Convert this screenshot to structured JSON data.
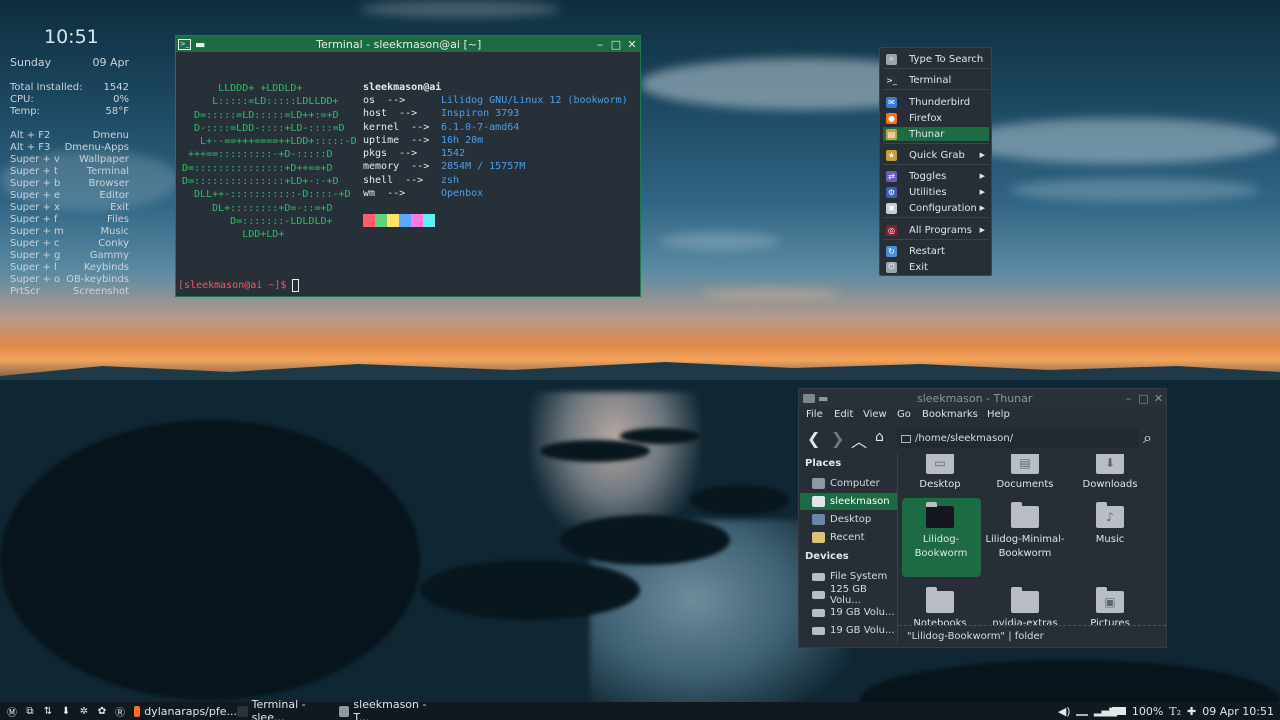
{
  "conky": {
    "time": "10:51",
    "day": "Sunday",
    "date": "09 Apr",
    "stats": [
      {
        "label": "Total Installed:",
        "value": "1542"
      },
      {
        "label": "CPU:",
        "value": "0%"
      },
      {
        "label": "Temp:",
        "value": "58°F"
      }
    ],
    "keybinds": [
      {
        "key": "Alt + F2",
        "action": "Dmenu"
      },
      {
        "key": "Alt + F3",
        "action": "Dmenu-Apps"
      },
      {
        "key": "Super + v",
        "action": "Wallpaper"
      },
      {
        "key": "Super + t",
        "action": "Terminal"
      },
      {
        "key": "Super + b",
        "action": "Browser"
      },
      {
        "key": "Super + e",
        "action": "Editor"
      },
      {
        "key": "Super + x",
        "action": "Exit"
      },
      {
        "key": "Super + f",
        "action": "Files"
      },
      {
        "key": "Super + m",
        "action": "Music"
      },
      {
        "key": "Super + c",
        "action": "Conky"
      },
      {
        "key": "Super + g",
        "action": "Gammy"
      },
      {
        "key": "Super + l",
        "action": "Keybinds"
      },
      {
        "key": "Super + o",
        "action": "OB-keybinds"
      },
      {
        "key": "PrtScr",
        "action": "Screenshot"
      }
    ]
  },
  "terminal": {
    "title": "Terminal - sleekmason@ai [~]",
    "logo": "      LLDDD+ +LDDLD+\n     L:::::=LD:::::LDLLDD+\n  D=:::::=LD:::::=LD++:=+D\n  D-::::=LDD-::::+LD-::::=D\n   L+--==+++====++LDD+:::::-D\n +++==:::::::::-+D-:::::D\nD=:::::::::::::::+D++==+D\nD=:::::::::::::::+LD+-:-+D\n  DLL++-:::::::::::-D::::-+D\n     DL+::::::::+D=-::=+D\n        D=:::::::-LDLDLD+\n          LDD+LD+",
    "user": "sleekmason@ai",
    "info_keys": "os  -->\nhost  -->\nkernel  -->\nuptime  -->\npkgs  -->\nmemory  -->\nshell  -->\nwm  -->",
    "info_values": "Lilidog GNU/Linux 12 (bookworm)\nInspiron 3793\n6.1.0-7-amd64\n16h 20m\n1542\n2854M / 15757M\nzsh\nOpenbox",
    "palette": [
      "#ff5c6e",
      "#5fd37a",
      "#ffe26a",
      "#5aa7ff",
      "#ff7ae0",
      "#5ff0f2"
    ],
    "prompt": "[sleekmason@ai ~]$ ",
    "colors": {
      "logo": "#25c464",
      "key": "#e6ecef",
      "value": "#4f9ee5",
      "prompt": "#f05a64"
    }
  },
  "menu": {
    "items": [
      {
        "label": "Type To Search",
        "icon": "search-icon",
        "color": "#9aa4ab",
        "submenu": false,
        "active": false
      },
      {
        "label": "Terminal",
        "icon": "terminal-icon",
        "color": "#2b3239",
        "submenu": false,
        "active": false
      },
      {
        "label": "Thunderbird",
        "icon": "thunderbird-icon",
        "color": "#3a7bd5",
        "submenu": false,
        "active": false
      },
      {
        "label": "Firefox",
        "icon": "firefox-icon",
        "color": "#ff6d1f",
        "submenu": false,
        "active": false
      },
      {
        "label": "Thunar",
        "icon": "thunar-icon",
        "color": "#c8a13c",
        "submenu": false,
        "active": true
      },
      {
        "label": "Quick Grab",
        "icon": "quick-grab-icon",
        "color": "#c79c3a",
        "submenu": true,
        "active": false
      },
      {
        "label": "Toggles",
        "icon": "toggles-icon",
        "color": "#6b5fb8",
        "submenu": true,
        "active": false
      },
      {
        "label": "Utilities",
        "icon": "utilities-icon",
        "color": "#3b5fb3",
        "submenu": true,
        "active": false
      },
      {
        "label": "Configuration",
        "icon": "configuration-icon",
        "color": "#c8cdd1",
        "submenu": true,
        "active": false
      },
      {
        "label": "All Programs",
        "icon": "debian-icon",
        "color": "#8a1c2e",
        "submenu": true,
        "active": false
      },
      {
        "label": "Restart",
        "icon": "restart-icon",
        "color": "#4a8fd6",
        "submenu": false,
        "active": false
      },
      {
        "label": "Exit",
        "icon": "exit-icon",
        "color": "#9aa4ab",
        "submenu": false,
        "active": false
      }
    ]
  },
  "thunar": {
    "title": "sleekmason - Thunar",
    "menubar": [
      "File",
      "Edit",
      "View",
      "Go",
      "Bookmarks",
      "Help"
    ],
    "path": "/home/sleekmason/",
    "places_heading": "Places",
    "places": [
      {
        "label": "Computer",
        "icon": "computer-icon",
        "selected": false
      },
      {
        "label": "sleekmason",
        "icon": "home-icon",
        "selected": true
      },
      {
        "label": "Desktop",
        "icon": "desktop-icon",
        "selected": false
      },
      {
        "label": "Recent",
        "icon": "recent-icon",
        "selected": false
      }
    ],
    "devices_heading": "Devices",
    "devices": [
      {
        "label": "File System",
        "icon": "drive-icon"
      },
      {
        "label": "125 GB Volu...",
        "icon": "drive-icon"
      },
      {
        "label": "19 GB Volu...",
        "icon": "drive-icon"
      },
      {
        "label": "19 GB Volu...",
        "icon": "drive-icon"
      }
    ],
    "files": [
      {
        "label": "Desktop",
        "icon": "desktop-folder-icon",
        "selected": false
      },
      {
        "label": "Documents",
        "icon": "documents-folder-icon",
        "selected": false
      },
      {
        "label": "Downloads",
        "icon": "downloads-folder-icon",
        "selected": false
      },
      {
        "label": "Lilidog-\nBookworm",
        "icon": "folder-icon",
        "selected": true
      },
      {
        "label": "Lilidog-Minimal-\nBookworm",
        "icon": "folder-icon",
        "selected": false
      },
      {
        "label": "Music",
        "icon": "music-folder-icon",
        "selected": false
      },
      {
        "label": "Notebooks",
        "icon": "folder-icon",
        "selected": false
      },
      {
        "label": "nvidia-extras",
        "icon": "folder-icon",
        "selected": false
      },
      {
        "label": "Pictures",
        "icon": "pictures-folder-icon",
        "selected": false
      }
    ],
    "status": "\"Lilidog-Bookworm\"  |  folder"
  },
  "taskbar": {
    "launchers": [
      "menu-icon",
      "windows-icon",
      "network-icon",
      "download-icon",
      "settings-icon",
      "paw-icon",
      "r-icon"
    ],
    "tasks": [
      {
        "label": "dylanaraps/pfe...",
        "icon": "firefox-icon",
        "color": "#ff6d1f"
      },
      {
        "label": "Terminal - slee...",
        "icon": "terminal-icon",
        "color": "#2b3239"
      },
      {
        "label": "sleekmason - T...",
        "icon": "folder-icon",
        "color": "#8d98a0"
      }
    ],
    "battery": "100%",
    "clock": "09 Apr 10:51"
  }
}
